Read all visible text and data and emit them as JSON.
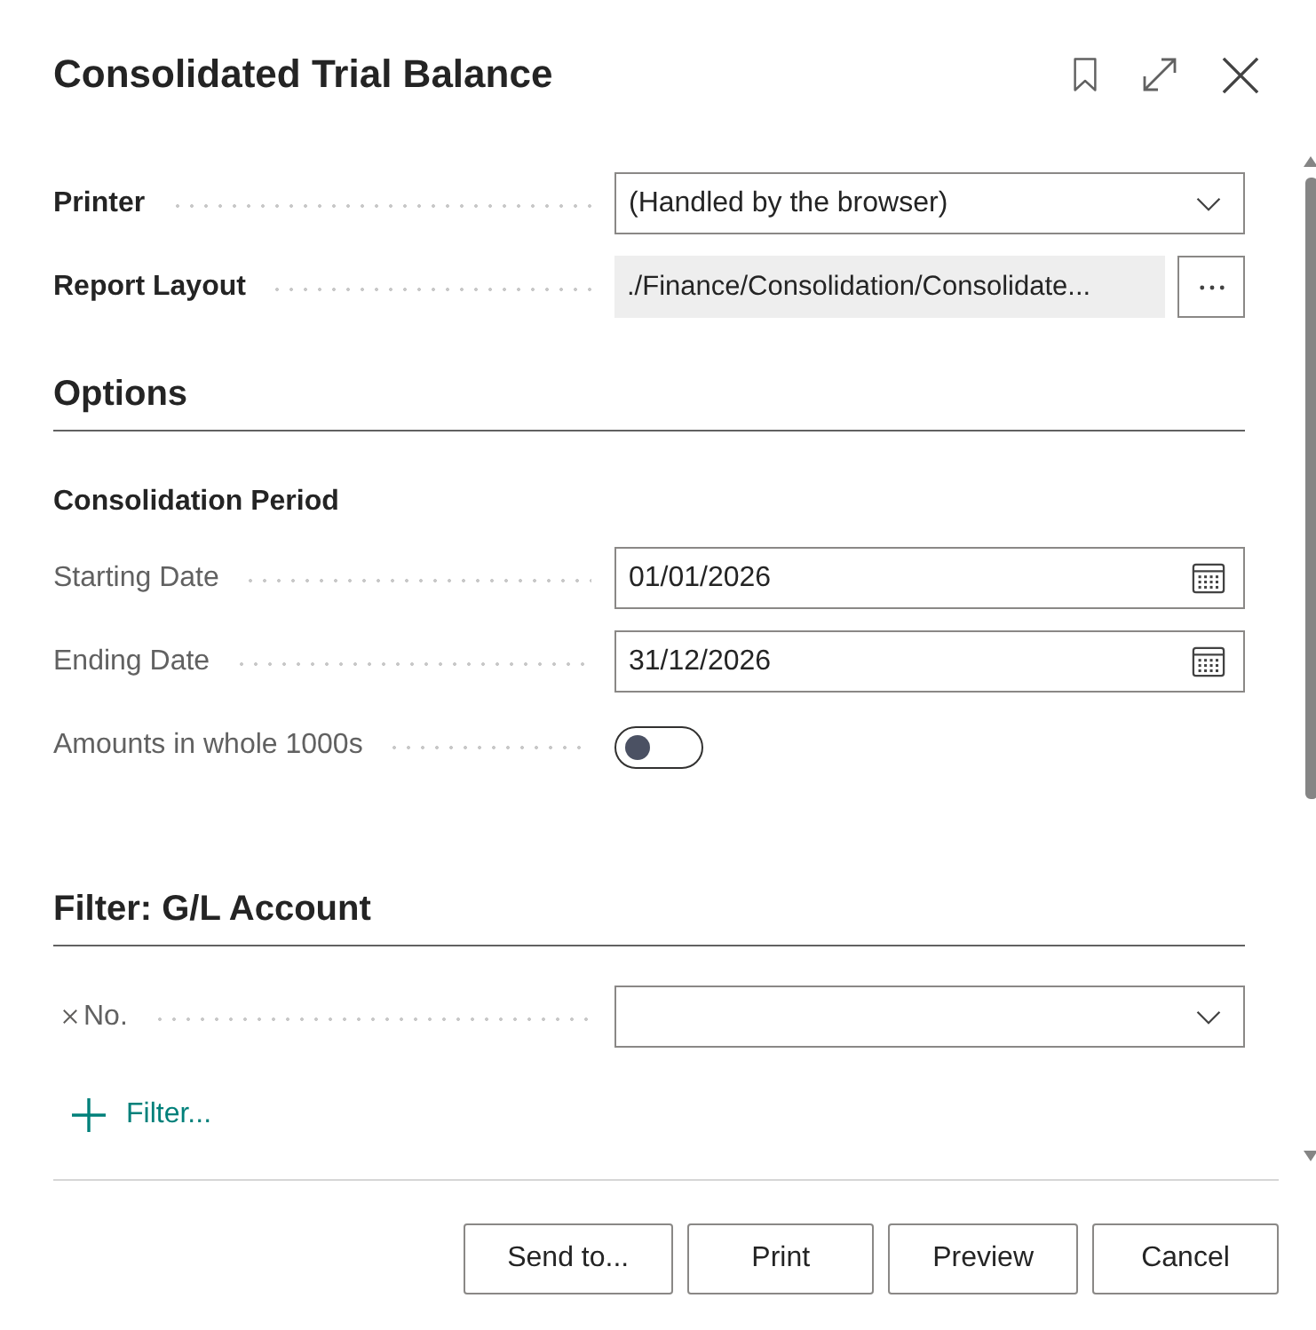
{
  "dialog": {
    "title": "Consolidated Trial Balance"
  },
  "header_fields": [
    {
      "kind": "select",
      "label": "Printer",
      "value": "(Handled by the browser)",
      "emphasized": true
    },
    {
      "kind": "layout",
      "label": "Report Layout",
      "value": "./Finance/Consolidation/Consolidate...",
      "emphasized": true
    }
  ],
  "sections": [
    {
      "title": "Options",
      "subheading": "Consolidation Period",
      "fields": [
        {
          "kind": "date",
          "label": "Starting Date",
          "value": "01/01/2026",
          "emphasized": false
        },
        {
          "kind": "date",
          "label": "Ending Date",
          "value": "31/12/2026",
          "emphasized": false
        },
        {
          "kind": "toggle",
          "label": "Amounts in whole 1000s",
          "on": false,
          "emphasized": false
        }
      ]
    },
    {
      "title": "Filter: G/L Account",
      "fields": [
        {
          "kind": "select",
          "label": "No.",
          "removable": true,
          "emphasized": false
        }
      ],
      "add_filter": "Filter..."
    }
  ],
  "buttons": [
    "Send to...",
    "Print",
    "Preview",
    "Cancel"
  ]
}
